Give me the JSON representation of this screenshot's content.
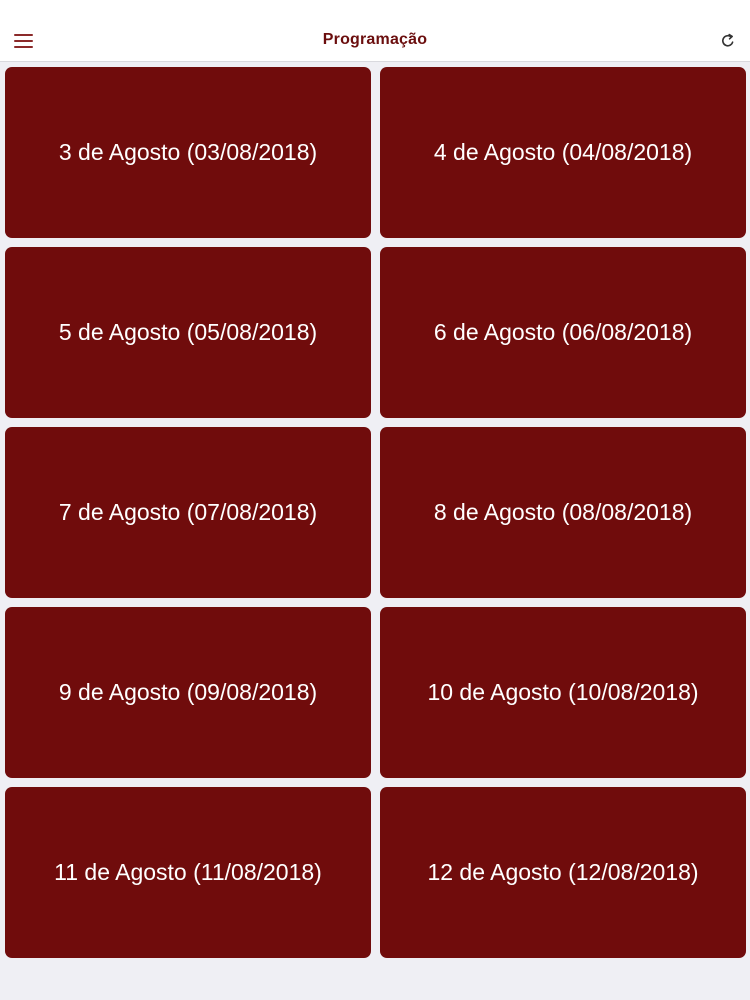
{
  "colors": {
    "accent": "#700c0c",
    "title": "#6b0e0e",
    "background": "#efeff4",
    "card_text": "#ffffff"
  },
  "navbar": {
    "title": "Programação",
    "left_icon": "menu-icon",
    "right_icon": "refresh-icon"
  },
  "days": [
    {
      "label": "3 de Agosto (03/08/2018)"
    },
    {
      "label": "4 de Agosto (04/08/2018)"
    },
    {
      "label": "5 de Agosto (05/08/2018)"
    },
    {
      "label": "6 de Agosto (06/08/2018)"
    },
    {
      "label": "7 de Agosto (07/08/2018)"
    },
    {
      "label": "8 de Agosto (08/08/2018)"
    },
    {
      "label": "9 de Agosto (09/08/2018)"
    },
    {
      "label": "10 de Agosto (10/08/2018)"
    },
    {
      "label": "11 de Agosto (11/08/2018)"
    },
    {
      "label": "12 de Agosto (12/08/2018)"
    }
  ]
}
